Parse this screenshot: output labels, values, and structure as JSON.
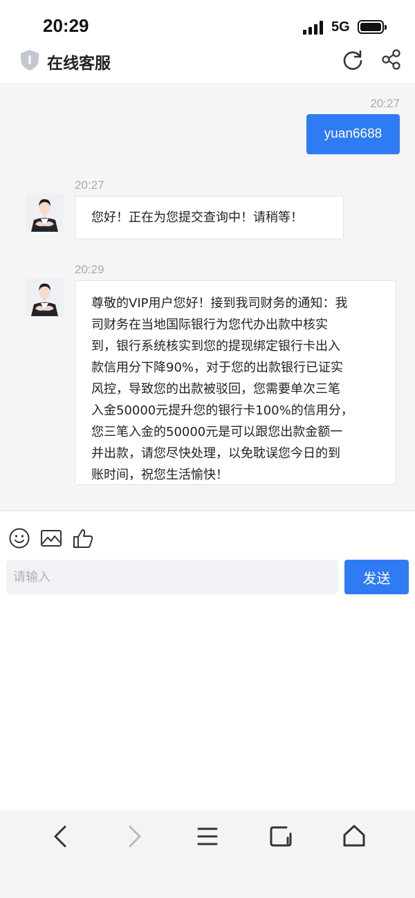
{
  "status_bar": {
    "time": "20:29",
    "network": "5G"
  },
  "header": {
    "title": "在线客服",
    "icons": [
      "shield-icon",
      "refresh-icon",
      "share-icon"
    ]
  },
  "chat": {
    "messages": [
      {
        "from": "user",
        "time": "20:27",
        "text": "yuan6688"
      },
      {
        "from": "agent",
        "time": "20:27",
        "text": "您好！正在为您提交查询中！请稍等！"
      },
      {
        "from": "agent",
        "time": "20:29",
        "lines": [
          "尊敬的VIP用户您好！接到我司财务的通知：我",
          "司财务在当地国际银行为您代办出款中核实",
          "到，银行系统核实到您的提现绑定银行卡出入",
          "款信用分下降90%，对于您的出款银行已证实",
          "风控，导致您的出款被驳回，您需要单次三笔",
          "入金50000元提升您的银行卡100%的信用分，",
          "您三笔入金的50000元是可以跟您出款金额一",
          "并出款，请您尽快处理，以免耽误您今日的到",
          "账时间，祝您生活愉快！"
        ]
      }
    ]
  },
  "composer": {
    "tools": [
      "emoji-icon",
      "image-icon",
      "thumbs-up-icon"
    ],
    "placeholder": "请输入",
    "value": "",
    "send_label": "发送"
  },
  "browser_nav": [
    "back-icon",
    "forward-icon",
    "menu-icon",
    "tabs-icon",
    "home-icon"
  ],
  "colors": {
    "accent": "#2f7bf3",
    "chat_bg": "#f5f5f7"
  }
}
